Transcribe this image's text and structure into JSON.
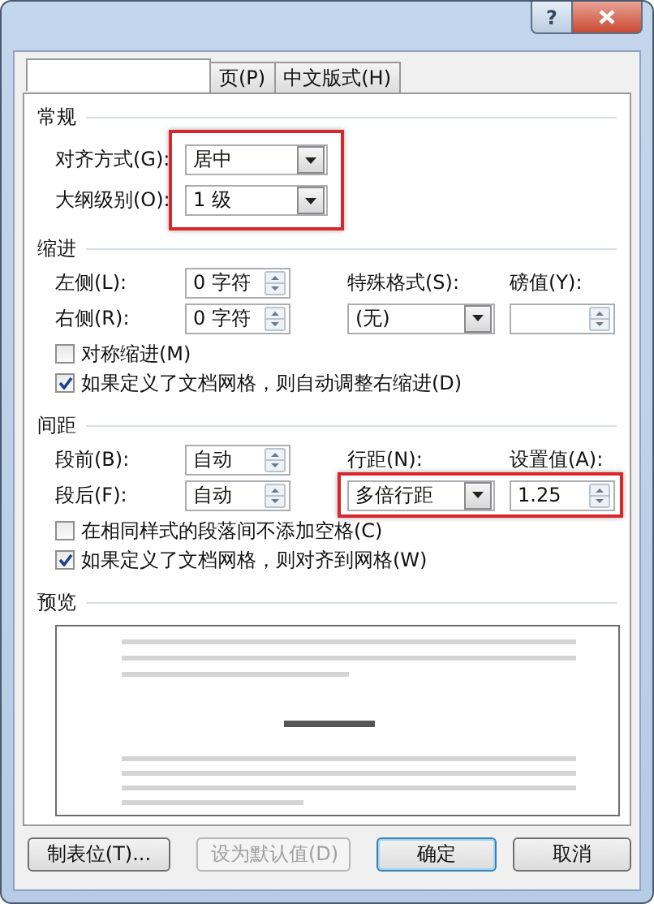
{
  "title_bar": {
    "help": "?"
  },
  "tabs": [
    {
      "selected": true
    },
    {
      "label": "页(P)",
      "selected": false
    },
    {
      "label": "中文版式(H)",
      "selected": false
    }
  ],
  "sections": [
    {
      "heading": "常规",
      "highlighted": true,
      "rows": [
        [
          {
            "kind": "label",
            "text": "对齐方式(G):"
          },
          {
            "kind": "dropdown",
            "value": "居中"
          }
        ],
        [
          {
            "kind": "label",
            "text": "大纲级别(O):"
          },
          {
            "kind": "dropdown",
            "value": "1 级"
          }
        ]
      ]
    },
    {
      "heading": "缩进",
      "rows": [
        [
          {
            "kind": "label",
            "text": "左侧(L):"
          },
          {
            "kind": "spin",
            "value": "0 字符"
          },
          {
            "kind": "label",
            "text": "特殊格式(S):"
          },
          {
            "kind": "label",
            "text": "磅值(Y):"
          }
        ],
        [
          {
            "kind": "label",
            "text": "右侧(R):"
          },
          {
            "kind": "spin",
            "value": "0 字符"
          },
          {
            "kind": "dropdown",
            "value": "(无)"
          },
          {
            "kind": "spin"
          }
        ]
      ],
      "checkboxes": [
        {
          "label": "对称缩进(M)",
          "checked": false
        },
        {
          "label": "如果定义了文档网格，则自动调整右缩进(D)",
          "checked": true
        }
      ]
    },
    {
      "heading": "间距",
      "highlighted": true,
      "rows": [
        [
          {
            "kind": "label",
            "text": "段前(B):"
          },
          {
            "kind": "spin",
            "value": "自动"
          },
          {
            "kind": "label",
            "text": "行距(N):"
          },
          {
            "kind": "label",
            "text": "设置值(A):"
          }
        ],
        [
          {
            "kind": "label",
            "text": "段后(F):"
          },
          {
            "kind": "spin",
            "value": "自动"
          },
          {
            "kind": "dropdown",
            "value": "多倍行距"
          },
          {
            "kind": "spin",
            "value": "1.25"
          }
        ]
      ],
      "checkboxes": [
        {
          "label": "在相同样式的段落间不添加空格(C)",
          "checked": false
        },
        {
          "label": "如果定义了文档网格，则对齐到网格(W)",
          "checked": true
        }
      ]
    }
  ],
  "preview": {
    "heading": "预览"
  },
  "buttons": [
    {
      "label": "制表位(T)...",
      "disabled": false,
      "default": false
    },
    {
      "label": "设为默认值(D)",
      "disabled": true,
      "default": false
    },
    {
      "label": "确定",
      "disabled": false,
      "default": true
    },
    {
      "label": "取消",
      "disabled": false,
      "default": false
    }
  ]
}
